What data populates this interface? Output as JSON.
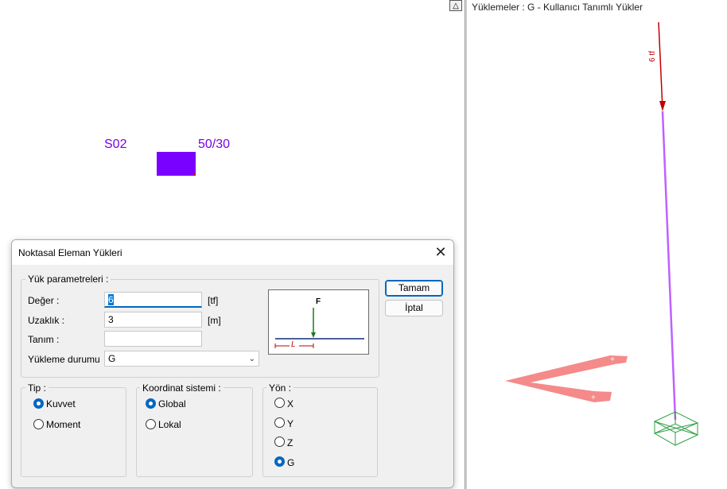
{
  "left_view": {
    "section_label": "S02",
    "size_label": "50/30",
    "column_color": "#7a00ff"
  },
  "right_view": {
    "title": "Yüklemeler : G - Kullanıcı Tanımlı Yükler",
    "load_label": "6 tf",
    "collapse_glyph": "△"
  },
  "dialog": {
    "title": "Noktasal  Eleman Yükleri",
    "close_glyph": "✕",
    "params_group": {
      "legend": "Yük parametreleri :",
      "value_label": "Değer :",
      "value": "6",
      "value_unit": "[tf]",
      "distance_label": "Uzaklık :",
      "distance": "3",
      "distance_unit": "[m]",
      "description_label": "Tanım :",
      "description": "",
      "load_case_label": "Yükleme durumu",
      "load_case": "G"
    },
    "diagram": {
      "force_label": "F",
      "length_label": "L"
    },
    "buttons": {
      "ok": "Tamam",
      "cancel": "İptal"
    },
    "type_group": {
      "legend": "Tip :",
      "options": [
        "Kuvvet",
        "Moment"
      ],
      "selected": "Kuvvet"
    },
    "coord_group": {
      "legend": "Koordinat sistemi :",
      "options": [
        "Global",
        "Lokal"
      ],
      "selected": "Global"
    },
    "direction_group": {
      "legend": "Yön :",
      "options": [
        "X",
        "Y",
        "Z",
        "G"
      ],
      "selected": "G"
    }
  }
}
